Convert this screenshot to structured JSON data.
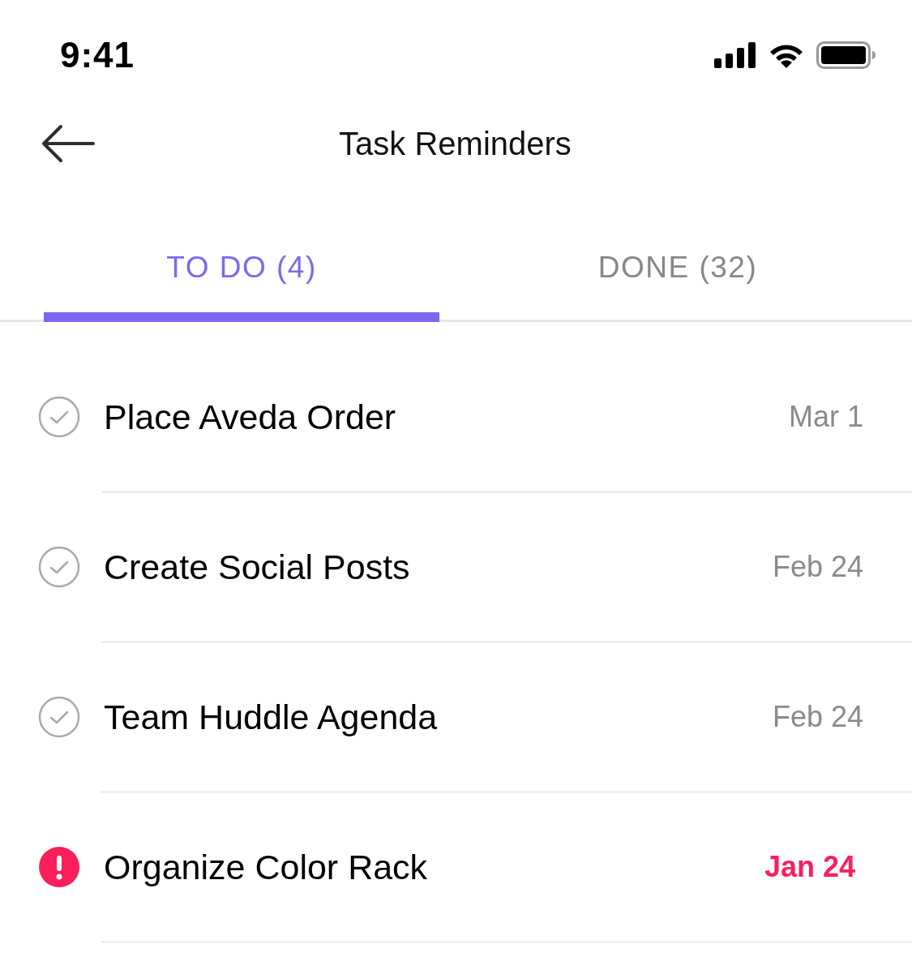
{
  "status_bar": {
    "time": "9:41"
  },
  "header": {
    "title": "Task Reminders"
  },
  "tabs": [
    {
      "label": "TO DO (4)",
      "selected": true
    },
    {
      "label": "DONE (32)",
      "selected": false
    }
  ],
  "tasks": [
    {
      "title": "Place Aveda Order",
      "date": "Mar 1",
      "overdue": false
    },
    {
      "title": "Create Social Posts",
      "date": "Feb 24",
      "overdue": false
    },
    {
      "title": "Team Huddle Agenda",
      "date": "Feb 24",
      "overdue": false
    },
    {
      "title": "Organize Color Rack",
      "date": "Jan 24",
      "overdue": true
    }
  ]
}
